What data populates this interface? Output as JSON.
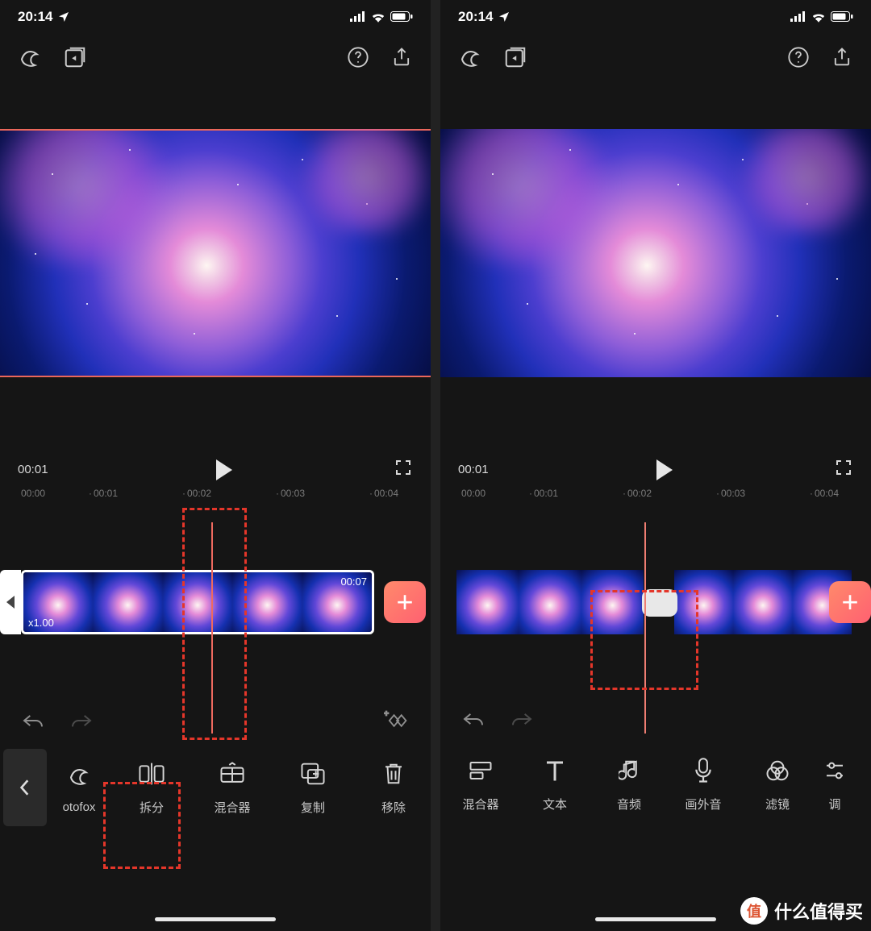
{
  "status": {
    "time": "20:14"
  },
  "playback": {
    "current": "00:01"
  },
  "ruler": {
    "ticks": [
      "00:00",
      "00:01",
      "00:02",
      "00:03",
      "00:04"
    ]
  },
  "clip": {
    "duration": "00:07",
    "speed": "x1.00"
  },
  "left": {
    "tools": [
      {
        "label": "otofox",
        "name": "photofox"
      },
      {
        "label": "拆分",
        "name": "split"
      },
      {
        "label": "混合器",
        "name": "mixer"
      },
      {
        "label": "复制",
        "name": "duplicate"
      },
      {
        "label": "移除",
        "name": "remove"
      }
    ]
  },
  "right": {
    "tools": [
      {
        "label": "混合器",
        "name": "mixer"
      },
      {
        "label": "文本",
        "name": "text"
      },
      {
        "label": "音频",
        "name": "audio"
      },
      {
        "label": "画外音",
        "name": "voiceover"
      },
      {
        "label": "滤镜",
        "name": "filter"
      },
      {
        "label": "调",
        "name": "adjust"
      }
    ]
  },
  "watermark": "什么值得买"
}
